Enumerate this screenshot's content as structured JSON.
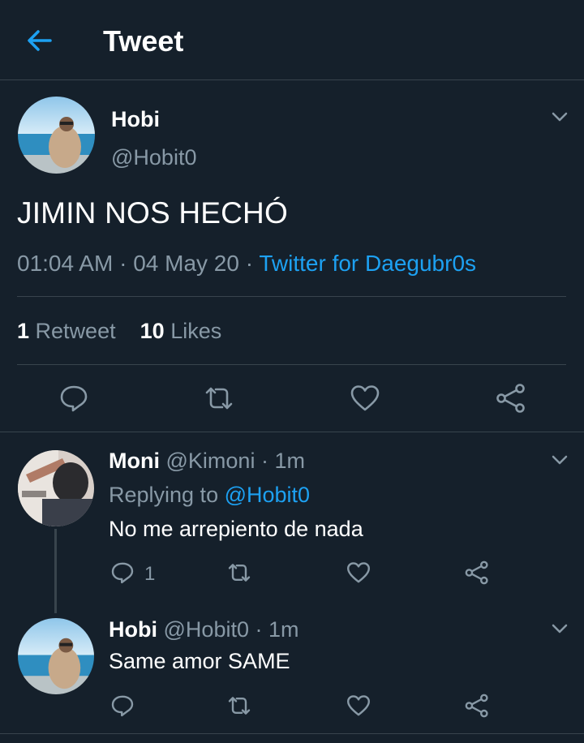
{
  "header": {
    "title": "Tweet"
  },
  "main_tweet": {
    "name": "Hobi",
    "handle": "@Hobit0",
    "text": "JIMIN NOS HECHÓ",
    "time": "01:04 AM",
    "date": "04 May 20",
    "source": "Twitter for Daegubr0s",
    "retweet_count": "1",
    "retweet_label": "Retweet",
    "like_count": "10",
    "like_label": "Likes"
  },
  "replies": [
    {
      "name": "Moni",
      "handle": "@Kimoni",
      "time": "1m",
      "replying_prefix": "Replying to",
      "replying_to": "@Hobit0",
      "text": "No me arrepiento de nada",
      "reply_count": "1"
    },
    {
      "name": "Hobi",
      "handle": "@Hobit0",
      "time": "1m",
      "text": "Same amor SAME"
    }
  ],
  "colors": {
    "background": "#15202b",
    "accent": "#1da1f2",
    "secondary_text": "#8899a6",
    "divider": "#38444d"
  },
  "icons": [
    "back-arrow-icon",
    "chevron-down-icon",
    "reply-icon",
    "retweet-icon",
    "like-icon",
    "share-icon"
  ]
}
